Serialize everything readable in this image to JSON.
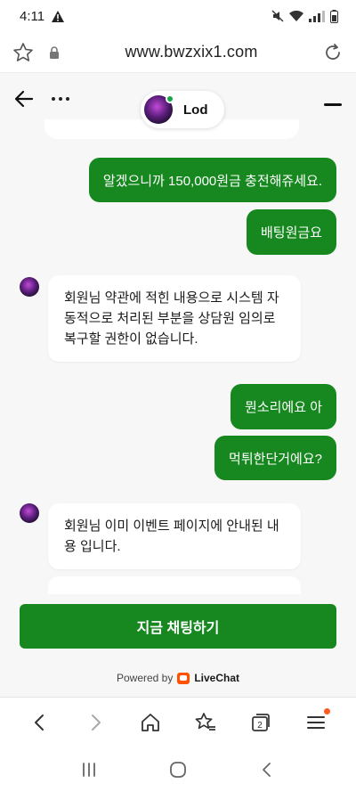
{
  "status_bar": {
    "time": "4:11"
  },
  "browser": {
    "url": "www.bwzxix1.com"
  },
  "chat": {
    "agent_name": "Lod",
    "messages": [
      {
        "from": "user",
        "text": "알겠으니까 150,000원금 충전해쥬세요."
      },
      {
        "from": "user",
        "text": "배팅원금요"
      },
      {
        "from": "agent",
        "lines": [
          "회원님 약관에 적힌 내용으로 시스템 자",
          "동적으로 처리된 부분을 상담원 임의로",
          "복구할 권한이 없습니다."
        ]
      },
      {
        "from": "user",
        "text": "뭔소리에요 아"
      },
      {
        "from": "user",
        "text": "먹튀한단거에요?"
      },
      {
        "from": "agent",
        "lines": [
          "회원님 이미 이벤트 페이지에 안내된 내",
          "용 입니다."
        ]
      }
    ],
    "cta_label": "지금 채팅하기",
    "powered_by": "Powered by",
    "brand": "LiveChat"
  },
  "colors": {
    "accent": "#16881f",
    "brand_orange": "#ff5100"
  },
  "icons": {
    "status": [
      "warning-icon",
      "mute-icon",
      "wifi-icon",
      "signal-icon",
      "battery-icon"
    ],
    "browser": [
      "bookmark-star-icon",
      "lock-icon",
      "reload-icon"
    ],
    "chat_header": [
      "back-arrow-icon",
      "more-dots-icon",
      "minimize-icon"
    ],
    "bottom_nav": [
      "back-icon",
      "forward-icon",
      "home-icon",
      "bookmarks-icon",
      "tabs-icon",
      "menu-icon"
    ],
    "system_nav": [
      "recents-icon",
      "home-circle-icon",
      "back-chevron-icon"
    ]
  },
  "tab_count": "2"
}
